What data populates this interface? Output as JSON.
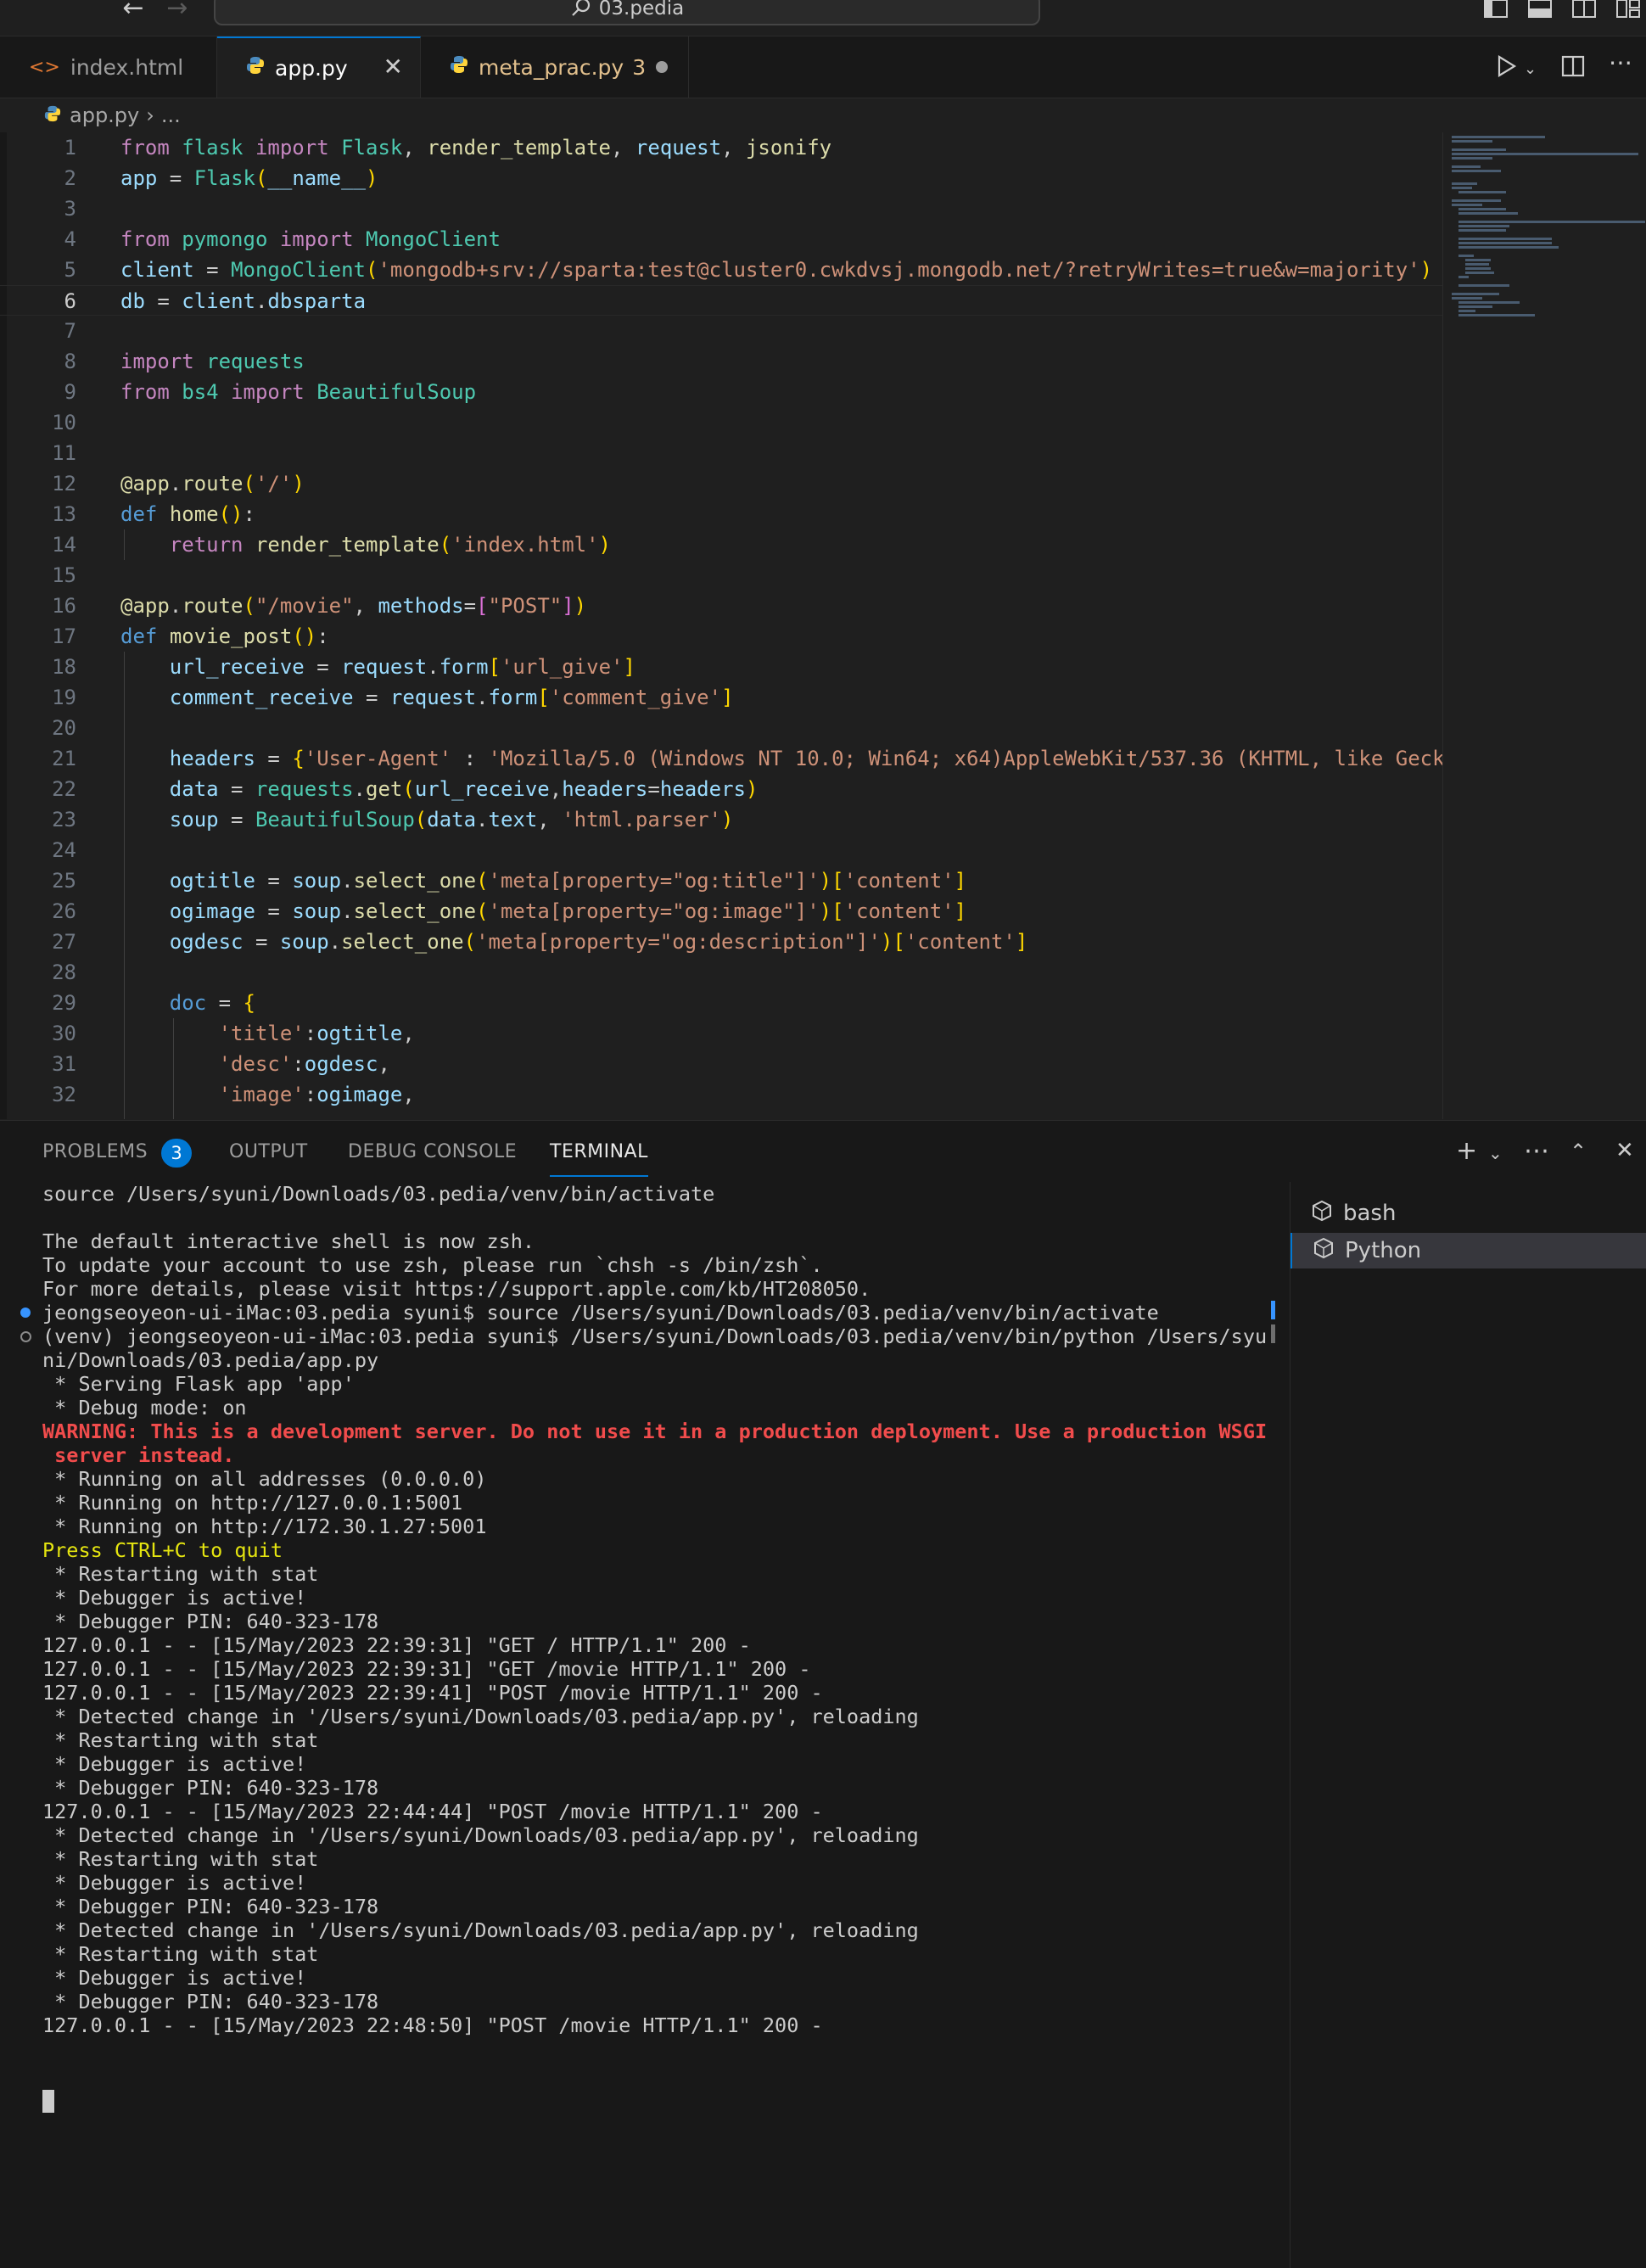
{
  "window": {
    "command_center": "03.pedia"
  },
  "tabs": [
    {
      "label": "index.html",
      "icon": "html-file-icon",
      "active": false
    },
    {
      "label": "app.py",
      "icon": "python-file-icon",
      "active": true
    },
    {
      "label": "meta_prac.py",
      "icon": "python-file-icon",
      "active": false,
      "problems": "3",
      "modified": true
    }
  ],
  "breadcrumb": {
    "file": "app.py",
    "rest": "..."
  },
  "editor": {
    "current_line": 6,
    "line_numbers": [
      "1",
      "2",
      "3",
      "4",
      "5",
      "6",
      "7",
      "8",
      "9",
      "10",
      "11",
      "12",
      "13",
      "14",
      "15",
      "16",
      "17",
      "18",
      "19",
      "20",
      "21",
      "22",
      "23",
      "24",
      "25",
      "26",
      "27",
      "28",
      "29",
      "30",
      "31",
      "32"
    ]
  },
  "panel": {
    "tabs": [
      "PROBLEMS",
      "OUTPUT",
      "DEBUG CONSOLE",
      "TERMINAL"
    ],
    "active_tab": "TERMINAL",
    "problems_count": "3",
    "terminals": [
      "bash",
      "Python"
    ],
    "selected_terminal": "Python",
    "lines": [
      "source /Users/syuni/Downloads/03.pedia/venv/bin/activate",
      "",
      "The default interactive shell is now zsh.",
      "To update your account to use zsh, please run `chsh -s /bin/zsh`.",
      "For more details, please visit https://support.apple.com/kb/HT208050.",
      "jeongseoyeon-ui-iMac:03.pedia syuni$ source /Users/syuni/Downloads/03.pedia/venv/bin/activate",
      "(venv) jeongseoyeon-ui-iMac:03.pedia syuni$ /Users/syuni/Downloads/03.pedia/venv/bin/python /Users/syu",
      "ni/Downloads/03.pedia/app.py",
      " * Serving Flask app 'app'",
      " * Debug mode: on",
      "WARNING: This is a development server. Do not use it in a production deployment. Use a production WSGI",
      " server instead.",
      " * Running on all addresses (0.0.0.0)",
      " * Running on http://127.0.0.1:5001",
      " * Running on http://172.30.1.27:5001",
      "Press CTRL+C to quit",
      " * Restarting with stat",
      " * Debugger is active!",
      " * Debugger PIN: 640-323-178",
      "127.0.0.1 - - [15/May/2023 22:39:31] \"GET / HTTP/1.1\" 200 -",
      "127.0.0.1 - - [15/May/2023 22:39:31] \"GET /movie HTTP/1.1\" 200 -",
      "127.0.0.1 - - [15/May/2023 22:39:41] \"POST /movie HTTP/1.1\" 200 -",
      " * Detected change in '/Users/syuni/Downloads/03.pedia/app.py', reloading",
      " * Restarting with stat",
      " * Debugger is active!",
      " * Debugger PIN: 640-323-178",
      "127.0.0.1 - - [15/May/2023 22:44:44] \"POST /movie HTTP/1.1\" 200 -",
      " * Detected change in '/Users/syuni/Downloads/03.pedia/app.py', reloading",
      " * Restarting with stat",
      " * Debugger is active!",
      " * Debugger PIN: 640-323-178",
      " * Detected change in '/Users/syuni/Downloads/03.pedia/app.py', reloading",
      " * Restarting with stat",
      " * Debugger is active!",
      " * Debugger PIN: 640-323-178",
      "127.0.0.1 - - [15/May/2023 22:48:50] \"POST /movie HTTP/1.1\" 200 -"
    ]
  },
  "colors": {
    "accent": "#0078d4",
    "warning_text": "#f14c4c",
    "quit_hint": "#e5e510"
  }
}
